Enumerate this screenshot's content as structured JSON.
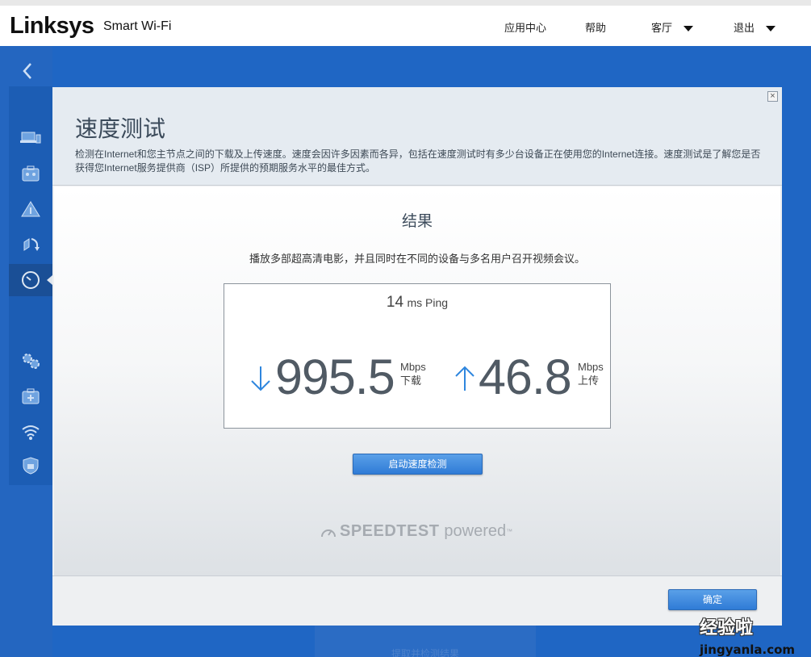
{
  "topbar": {
    "logo": "Linksys",
    "product": "Smart Wi-Fi",
    "nav": {
      "apps": "应用中心",
      "help": "帮助",
      "room": "客厅",
      "logout": "退出"
    }
  },
  "sidebar": {
    "icons": [
      "back-chevron-icon",
      "devices-icon",
      "parental-controls-icon",
      "network-map-icon",
      "media-prioritization-icon",
      "speed-test-icon",
      "settings-gears-icon",
      "troubleshooting-icon",
      "wifi-settings-icon",
      "security-icon"
    ]
  },
  "background": {
    "partial_text": "提取并检测结果"
  },
  "modal": {
    "title": "速度测试",
    "description": "检测在Internet和您主节点之间的下载及上传速度。速度会因许多因素而各异，包括在速度测试时有多少台设备正在使用您的Internet连接。速度测试是了解您是否获得您Internet服务提供商（ISP）所提供的预期服务水平的最佳方式。",
    "result_title": "结果",
    "result_sub": "播放多部超高清电影，并且同时在不同的设备与多名用户召开视频会议。",
    "ping": {
      "value": "14",
      "unit": "ms Ping"
    },
    "download": {
      "value": "995.5",
      "unit": "Mbps",
      "label": "下载"
    },
    "upload": {
      "value": "46.8",
      "unit": "Mbps",
      "label": "上传"
    },
    "start_button": "启动速度检测",
    "powered_by": {
      "brand": "SPEEDTEST",
      "suffix": "powered",
      "tm": "™"
    },
    "ok_button": "确定"
  },
  "watermark": {
    "cn": "经验啦",
    "en": "jingyanla.com"
  },
  "colors": {
    "sidebar_blue": "#2466c0",
    "button_blue": "#2f7bd6",
    "arrow_blue": "#2e86de"
  }
}
